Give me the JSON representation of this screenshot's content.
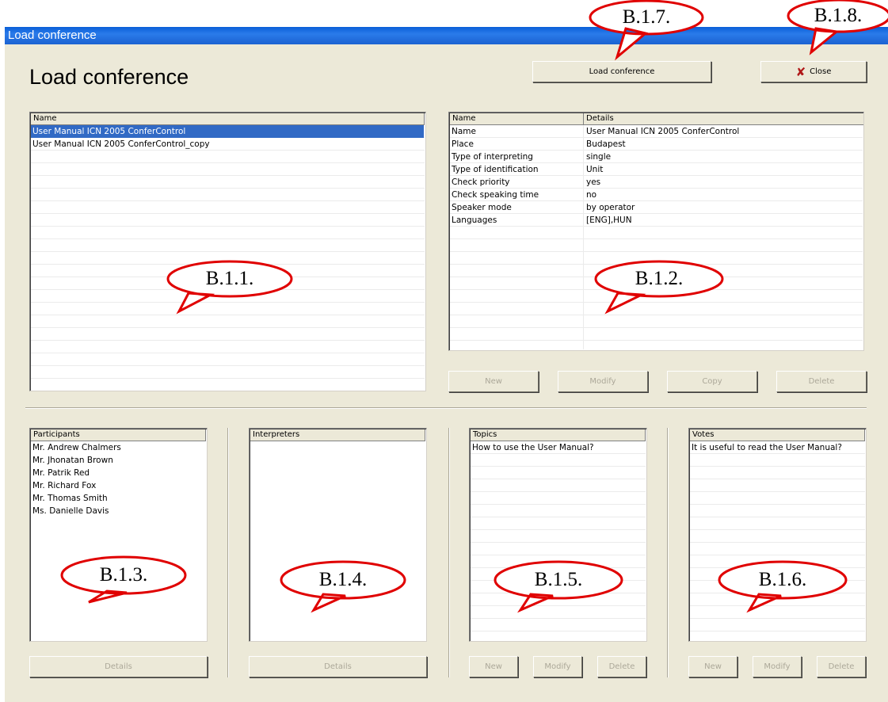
{
  "window": {
    "title": "Load conference"
  },
  "heading": "Load conference",
  "buttons": {
    "load_conference": "Load conference",
    "close": "Close",
    "conf_new": "New",
    "conf_modify": "Modify",
    "conf_copy": "Copy",
    "conf_delete": "Delete",
    "participants_details": "Details",
    "interpreters_details": "Details",
    "topics_new": "New",
    "topics_modify": "Modify",
    "topics_delete": "Delete",
    "votes_new": "New",
    "votes_modify": "Modify",
    "votes_delete": "Delete"
  },
  "conferences": {
    "header": "Name",
    "items": [
      "User Manual ICN 2005 ConferControl",
      "User Manual ICN 2005 ConferControl_copy"
    ],
    "selected_index": 0
  },
  "details": {
    "headers": [
      "Name",
      "Details"
    ],
    "rows": [
      [
        "Name",
        "User Manual ICN 2005 ConferControl"
      ],
      [
        "Place",
        "Budapest"
      ],
      [
        "Type of interpreting",
        "single"
      ],
      [
        "Type of identification",
        "Unit"
      ],
      [
        "Check priority",
        "yes"
      ],
      [
        "Check speaking time",
        "no"
      ],
      [
        "Speaker mode",
        "by operator"
      ],
      [
        "Languages",
        "[ENG],HUN"
      ]
    ]
  },
  "participants": {
    "header": "Participants",
    "items": [
      "Mr. Andrew Chalmers",
      "Mr. Jhonatan Brown",
      "Mr. Patrik Red",
      "Mr. Richard Fox",
      "Mr. Thomas Smith",
      "Ms. Danielle Davis"
    ]
  },
  "interpreters": {
    "header": "Interpreters",
    "items": []
  },
  "topics": {
    "header": "Topics",
    "items": [
      "How to use the User Manual?"
    ]
  },
  "votes": {
    "header": "Votes",
    "items": [
      "It is useful to read the User Manual?"
    ]
  },
  "callouts": {
    "b111": "B.1.1.",
    "b112": "B.1.2.",
    "b113": "B.1.3.",
    "b114": "B.1.4.",
    "b115": "B.1.5.",
    "b116": "B.1.6.",
    "b117": "B.1.7.",
    "b118": "B.1.8."
  },
  "colors": {
    "callout_stroke": "#e00000",
    "selection": "#316ac5",
    "titlebar": "#0a5fd8",
    "window_bg": "#ece9d8"
  }
}
